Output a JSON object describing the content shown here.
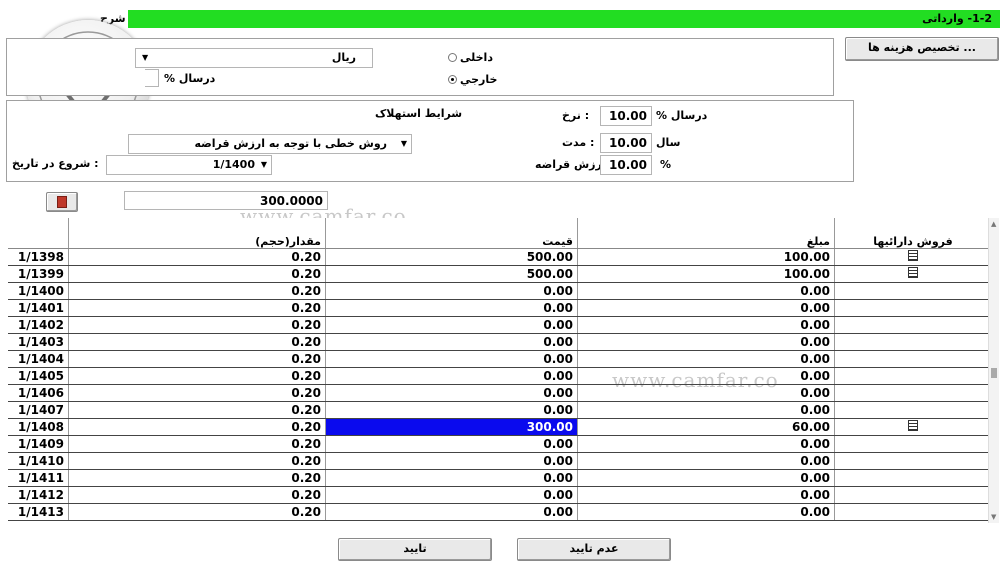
{
  "header": {
    "title": "1-2- وارداتی",
    "sharh_label": "شرح"
  },
  "top": {
    "allocate_button": "... تخصیص هزینه ها",
    "currency_value": "ریال",
    "dar_sal_pct_label": "درسال %",
    "radio_internal": "داخلی",
    "radio_external": "خارجي",
    "selected_radio": "external"
  },
  "depreciation": {
    "section_title": "شرایط استهلاک",
    "method_value": "روش خطی با توجه به ارزش قراضه",
    "start_date_label": ": شروع در تاریخ",
    "start_date_value": "1/1400",
    "rate_label": ": نرخ",
    "rate_value": "10.00",
    "rate_unit": "درسال %",
    "duration_label": ": مدت",
    "duration_value": "10.00",
    "duration_unit": "سال",
    "salvage_label": ": ارزش قراضه",
    "salvage_value": "10.00",
    "salvage_unit": "%"
  },
  "total_value": "300.0000",
  "watermark": "www.camfar.co",
  "table": {
    "headers": {
      "quantity": "مقدار(حجم)",
      "price": "قیمت",
      "amount": "مبلغ",
      "sale": "فروش دارائیها"
    },
    "rows": [
      {
        "code": "1/1398",
        "qty": "0.20",
        "price": "500.00",
        "amount": "100.00",
        "icon": true
      },
      {
        "code": "1/1399",
        "qty": "0.20",
        "price": "500.00",
        "amount": "100.00",
        "icon": true
      },
      {
        "code": "1/1400",
        "qty": "0.20",
        "price": "0.00",
        "amount": "0.00",
        "icon": false
      },
      {
        "code": "1/1401",
        "qty": "0.20",
        "price": "0.00",
        "amount": "0.00",
        "icon": false
      },
      {
        "code": "1/1402",
        "qty": "0.20",
        "price": "0.00",
        "amount": "0.00",
        "icon": false
      },
      {
        "code": "1/1403",
        "qty": "0.20",
        "price": "0.00",
        "amount": "0.00",
        "icon": false
      },
      {
        "code": "1/1404",
        "qty": "0.20",
        "price": "0.00",
        "amount": "0.00",
        "icon": false
      },
      {
        "code": "1/1405",
        "qty": "0.20",
        "price": "0.00",
        "amount": "0.00",
        "icon": false
      },
      {
        "code": "1/1406",
        "qty": "0.20",
        "price": "0.00",
        "amount": "0.00",
        "icon": false
      },
      {
        "code": "1/1407",
        "qty": "0.20",
        "price": "0.00",
        "amount": "0.00",
        "icon": false
      },
      {
        "code": "1/1408",
        "qty": "0.20",
        "price": "300.00",
        "amount": "60.00",
        "icon": true,
        "selected": true
      },
      {
        "code": "1/1409",
        "qty": "0.20",
        "price": "0.00",
        "amount": "0.00",
        "icon": false
      },
      {
        "code": "1/1410",
        "qty": "0.20",
        "price": "0.00",
        "amount": "0.00",
        "icon": false
      },
      {
        "code": "1/1411",
        "qty": "0.20",
        "price": "0.00",
        "amount": "0.00",
        "icon": false
      },
      {
        "code": "1/1412",
        "qty": "0.20",
        "price": "0.00",
        "amount": "0.00",
        "icon": false
      },
      {
        "code": "1/1413",
        "qty": "0.20",
        "price": "0.00",
        "amount": "0.00",
        "icon": false
      }
    ]
  },
  "footer": {
    "cancel_label": "عدم تایید",
    "ok_label": "تایید"
  },
  "colors": {
    "title_bar": "#22dd22",
    "selection": "#0a0aee"
  }
}
